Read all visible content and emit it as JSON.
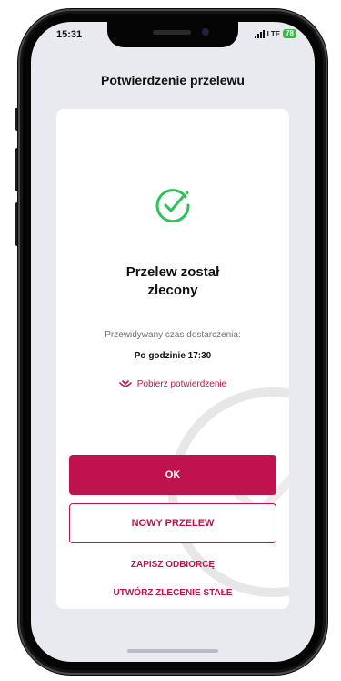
{
  "status_bar": {
    "time": "15:31",
    "network": "LTE",
    "battery": "78"
  },
  "header": {
    "title": "Potwierdzenie przelewu"
  },
  "confirmation": {
    "title_line1": "Przelew został",
    "title_line2": "zlecony",
    "delivery_label": "Przewidywany czas dostarczenia:",
    "delivery_time": "Po godzinie 17:30",
    "download_label": "Pobierz potwierdzenie"
  },
  "actions": {
    "ok_label": "OK",
    "new_transfer_label": "NOWY PRZELEW",
    "save_recipient_label": "ZAPISZ ODBIORCĘ",
    "create_standing_order_label": "UTWÓRZ ZLECENIE STAŁE"
  },
  "colors": {
    "accent": "#c0124f",
    "success": "#2ec05b",
    "background": "#e8eaef"
  },
  "icons": {
    "success": "check-circle-icon",
    "download": "download-icon"
  }
}
